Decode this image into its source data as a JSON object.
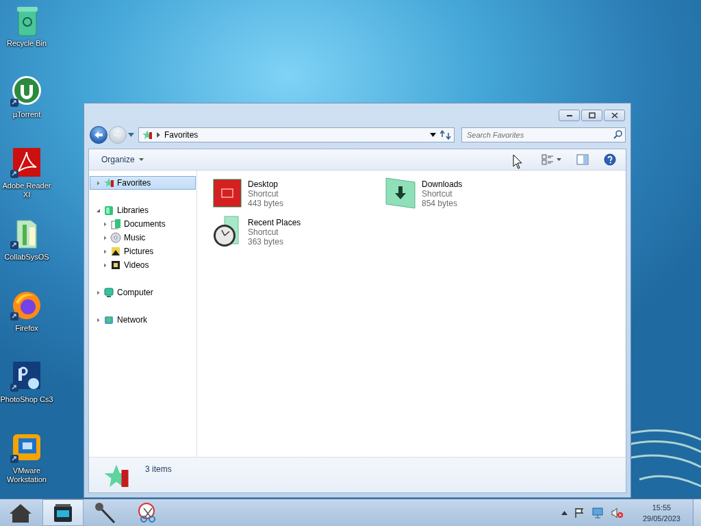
{
  "desktop_icons": [
    {
      "label": "Recycle Bin",
      "kind": "recycle",
      "shortcut": false
    },
    {
      "label": "µTorrent",
      "kind": "torrent",
      "shortcut": true
    },
    {
      "label": "Adobe Reader XI",
      "kind": "pdf",
      "shortcut": true
    },
    {
      "label": "CollabSysOS",
      "kind": "folder",
      "shortcut": true
    },
    {
      "label": "Firefox",
      "kind": "firefox",
      "shortcut": true
    },
    {
      "label": "PhotoShop Cs3",
      "kind": "photoshop",
      "shortcut": true
    },
    {
      "label": "VMware Workstation",
      "kind": "vmware",
      "shortcut": true
    }
  ],
  "window": {
    "address": {
      "path": "Favorites"
    },
    "search": {
      "placeholder": "Search Favorites"
    },
    "toolbar": {
      "organize": "Organize"
    },
    "nav": {
      "items": [
        {
          "label": "Favorites",
          "kind": "favorites",
          "selected": true,
          "expanded": false
        },
        {
          "label": "Libraries",
          "kind": "libraries",
          "selected": false,
          "expanded": true,
          "children": [
            {
              "label": "Documents",
              "kind": "documents",
              "selected": false,
              "expanded": false
            },
            {
              "label": "Music",
              "kind": "music",
              "selected": false,
              "expanded": false
            },
            {
              "label": "Pictures",
              "kind": "pictures",
              "selected": false,
              "expanded": false
            },
            {
              "label": "Videos",
              "kind": "videos",
              "selected": false,
              "expanded": false
            }
          ]
        },
        {
          "label": "Computer",
          "kind": "computer",
          "selected": false,
          "expanded": false
        },
        {
          "label": "Network",
          "kind": "network",
          "selected": false,
          "expanded": false
        }
      ]
    },
    "files": [
      {
        "name": "Desktop",
        "type": "Shortcut",
        "size": "443 bytes",
        "kind": "desktop"
      },
      {
        "name": "Downloads",
        "type": "Shortcut",
        "size": "854 bytes",
        "kind": "downloads"
      },
      {
        "name": "Recent Places",
        "type": "Shortcut",
        "size": "363 bytes",
        "kind": "recent"
      }
    ],
    "status": {
      "count": "3 items"
    }
  },
  "taskbar": {
    "apps": [
      {
        "kind": "start",
        "selected": false
      },
      {
        "kind": "explorer",
        "selected": true
      },
      {
        "kind": "microphone",
        "selected": false
      },
      {
        "kind": "snipping",
        "selected": false
      }
    ],
    "clock": {
      "time": "15:55",
      "date": "29/05/2023"
    }
  }
}
